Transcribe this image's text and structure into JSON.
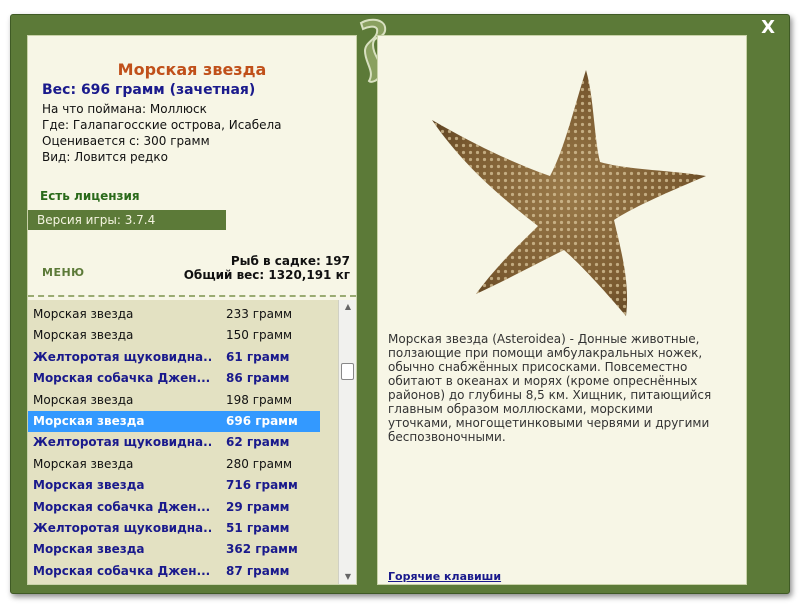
{
  "close_label": "X",
  "fish": {
    "name": "Морская звезда",
    "weight": "Вес: 696 грамм (зачетная)",
    "caught_on": "На что поймана: Моллюск",
    "location": "Где: Галапагосские острова, Исабела",
    "valued_from": "Оценивается с: 300 грамм",
    "kind": "Вид: Ловится редко",
    "description": "Морская звезда (Asteroidea) - Донные животные, ползающие при помощи амбулакральных ножек, обычно снабжённых присосками. Повсеместно обитают в океанах и морях (кроме опреснённых районов) до глубины 8,5 км. Хищник, питающийся главным образом моллюсками, морскими уточками, многощетинковыми червями и другими беспозвоночными."
  },
  "license": "Есть лицензия",
  "version": "Версия игры: 3.7.4",
  "menu_label": "МЕНЮ",
  "stats": {
    "fish_in_keepnet": "Рыб в садке: 197",
    "total_weight": "Общий вес: 1320,191 кг"
  },
  "catch_list": [
    {
      "name": "Морская звезда",
      "weight": "233 грамм",
      "style": "plain"
    },
    {
      "name": "Морская звезда",
      "weight": "150 грамм",
      "style": "plain"
    },
    {
      "name": "Желторотая щуковидна...",
      "weight": "61 грамм",
      "style": "bold"
    },
    {
      "name": "Морская собачка Джен...",
      "weight": "86 грамм",
      "style": "bold"
    },
    {
      "name": "Морская звезда",
      "weight": "198 грамм",
      "style": "plain"
    },
    {
      "name": "Морская звезда",
      "weight": "696 грамм",
      "style": "sel"
    },
    {
      "name": "Желторотая щуковидна...",
      "weight": "62 грамм",
      "style": "bold"
    },
    {
      "name": "Морская звезда",
      "weight": "280 грамм",
      "style": "plain"
    },
    {
      "name": "Морская звезда",
      "weight": "716 грамм",
      "style": "bold"
    },
    {
      "name": "Морская собачка Джен...",
      "weight": "29 грамм",
      "style": "bold"
    },
    {
      "name": "Желторотая щуковидна...",
      "weight": "51 грамм",
      "style": "bold"
    },
    {
      "name": "Морская звезда",
      "weight": "362 грамм",
      "style": "bold"
    },
    {
      "name": "Морская собачка Джен...",
      "weight": "87 грамм",
      "style": "bold"
    }
  ],
  "hotkeys_label": "Горячие клавиши",
  "colors": {
    "frame": "#5c7a38",
    "panel": "#f7f6e6",
    "selected": "#3399ff",
    "title": "#c0501a",
    "bold_text": "#1a1a8c"
  },
  "icons": {
    "close": "close-icon",
    "ornament": "leaf-ornament-icon",
    "scroll_up": "arrow-up-icon",
    "scroll_down": "arrow-down-icon"
  }
}
